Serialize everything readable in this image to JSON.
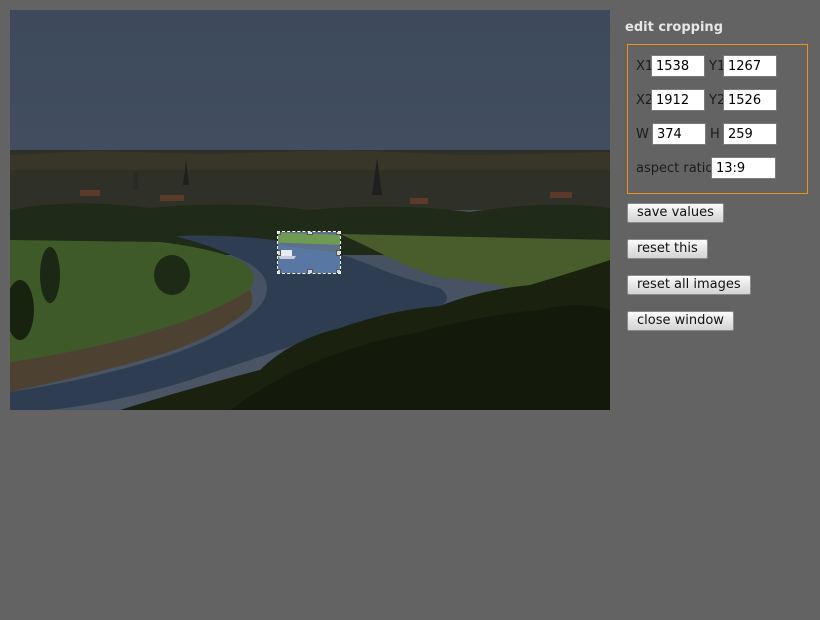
{
  "panel": {
    "title": "edit cropping",
    "x1_label": "X1",
    "x1_value": "1538",
    "y1_label": "Y1",
    "y1_value": "1267",
    "x2_label": "X2",
    "x2_value": "1912",
    "y2_label": "Y2",
    "y2_value": "1526",
    "w_label": "W",
    "w_value": "374",
    "h_label": "H",
    "h_value": "259",
    "aspect_label": "aspect ratio",
    "aspect_value": "13:9"
  },
  "buttons": {
    "save": "save values",
    "reset": "reset this",
    "reset_all": "reset all images",
    "close": "close window"
  },
  "colors": {
    "background": "#636363",
    "fieldset_border": "#e6941b",
    "title_text": "#e6e6e6"
  }
}
